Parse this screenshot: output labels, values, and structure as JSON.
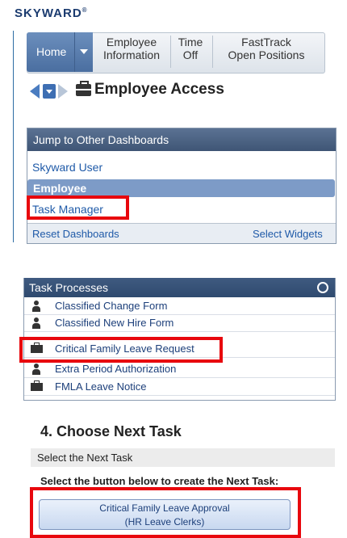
{
  "app": {
    "logo": "SKYWARD",
    "logo_mark": "®"
  },
  "nav": {
    "home": "Home",
    "items": [
      {
        "line1": "Employee",
        "line2": "Information"
      },
      {
        "line1": "Time",
        "line2": "Off"
      },
      {
        "line1": "FastTrack",
        "line2": "Open Positions"
      }
    ]
  },
  "header": {
    "title": "Employee Access"
  },
  "dashboards": {
    "title": "Jump to Other Dashboards",
    "items": [
      "Skyward User",
      "Employee",
      "Task Manager"
    ],
    "reset": "Reset Dashboards",
    "select": "Select Widgets"
  },
  "task_processes": {
    "title": "Task Processes",
    "items": [
      {
        "label": "Classified Change Form",
        "icon": "person-icon"
      },
      {
        "label": "Classified New Hire Form",
        "icon": "person-icon"
      },
      {
        "label": "Critical Family Leave Request",
        "icon": "briefcase-icon"
      },
      {
        "label": "Extra Period Authorization",
        "icon": "person-icon"
      },
      {
        "label": "FMLA Leave Notice",
        "icon": "briefcase-icon"
      }
    ]
  },
  "next_task": {
    "title": "4.  Choose Next Task",
    "band": "Select the Next Task",
    "instruction": "Select the button below to create the Next Task:",
    "button_line1": "Critical Family Leave Approval",
    "button_line2": "(HR Leave Clerks)"
  },
  "colors": {
    "highlight": "#e8070d",
    "header": "#3f5575",
    "link": "#1f5aa8"
  }
}
